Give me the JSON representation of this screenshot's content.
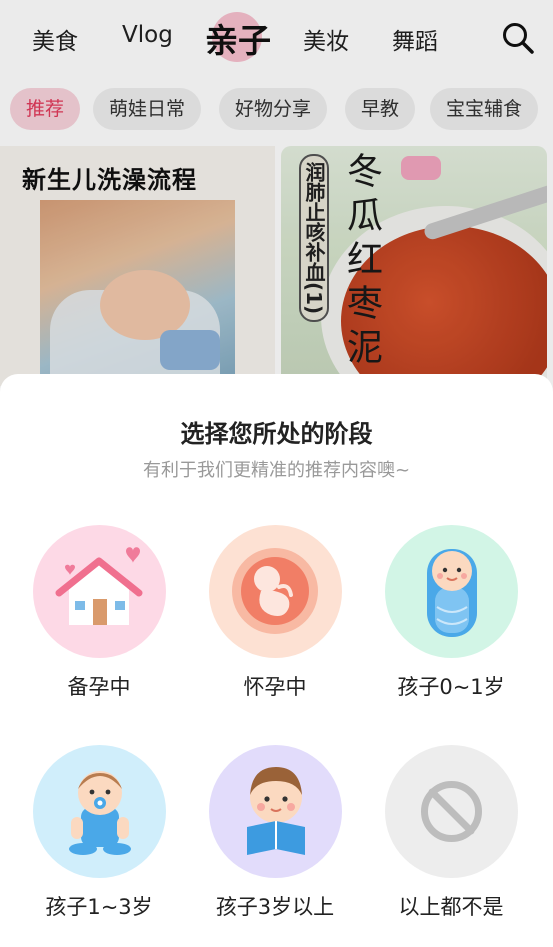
{
  "nav": {
    "tabs": [
      "美食",
      "Vlog",
      "亲子",
      "美妆",
      "舞蹈"
    ],
    "active_index": 2,
    "search_icon": "search-icon"
  },
  "chips": {
    "items": [
      "推荐",
      "萌娃日常",
      "好物分享",
      "早教",
      "宝宝辅食"
    ],
    "active_index": 0
  },
  "cards": {
    "left": {
      "title": "新生儿洗澡流程"
    },
    "right": {
      "label": "润肺止咳补血(1)",
      "calligraphy": "冬瓜红枣泥"
    }
  },
  "sheet": {
    "title": "选择您所处的阶段",
    "subtitle": "有利于我们更精准的推荐内容噢~",
    "options": [
      {
        "label": "备孕中",
        "icon": "house-hearts-icon",
        "color": "#fdd9e6"
      },
      {
        "label": "怀孕中",
        "icon": "fetus-icon",
        "color": "#fde1d3"
      },
      {
        "label": "孩子0~1岁",
        "icon": "swaddled-baby-icon",
        "color": "#d2f5e6"
      },
      {
        "label": "孩子1~3岁",
        "icon": "toddler-pacifier-icon",
        "color": "#d0eefb"
      },
      {
        "label": "孩子3岁以上",
        "icon": "child-reading-icon",
        "color": "#e2dcfb"
      },
      {
        "label": "以上都不是",
        "icon": "prohibited-icon",
        "color": "#ededed"
      }
    ]
  },
  "colors": {
    "accent": "#e23b5c",
    "chip_active_bg": "#f8d3dc"
  }
}
